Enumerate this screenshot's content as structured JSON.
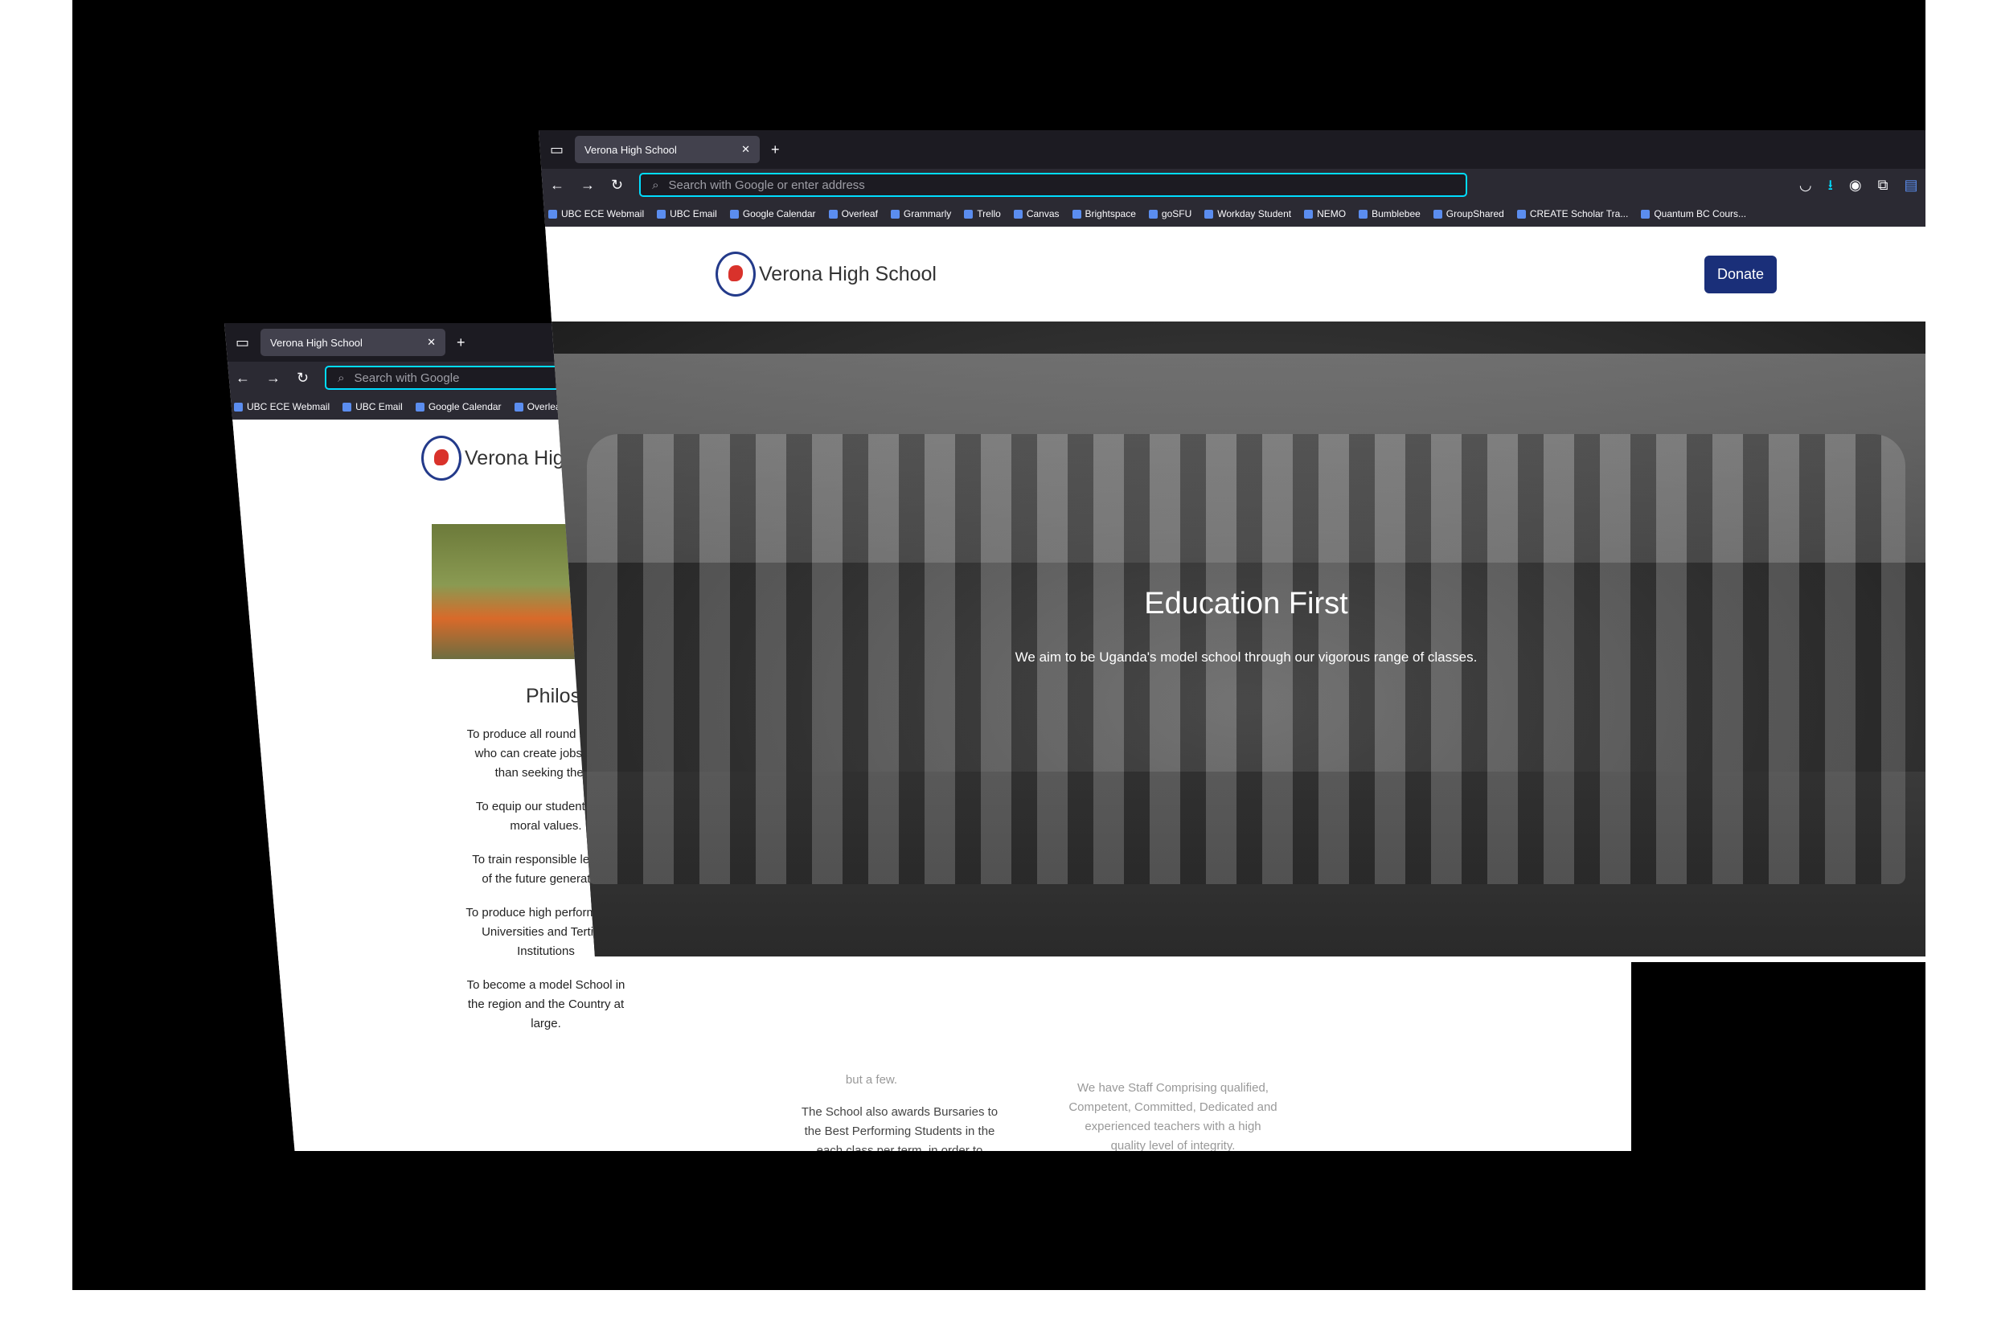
{
  "back_window": {
    "tab_title": "Verona High School",
    "url_placeholder": "Search with Google",
    "bookmarks": [
      "UBC ECE Webmail",
      "UBC Email",
      "Google Calendar",
      "Overleaf"
    ],
    "site_name": "Verona High School",
    "philosophy_title": "Philosophy",
    "philosophy_items": [
      "To produce all round students who can create jobs rather than seeking them.",
      "To equip our students with moral values.",
      "To train responsible leaders of the future generation.",
      "To produce high performers in Universities and Tertiary Institutions",
      "To become a model School in the region and the Country at large."
    ],
    "middle_text_top": "but a few.",
    "middle_text": "The School also awards Bursaries to the Best Performing Students in the each class per term, in order to promote competition among students.",
    "staff_text": "We have Staff Comprising qualified, Competent, Committed, Dedicated and experienced teachers with a high quality level of integrity."
  },
  "front_window": {
    "tab_title": "Verona High School",
    "url_placeholder": "Search with Google or enter address",
    "bookmarks": [
      "UBC ECE Webmail",
      "UBC Email",
      "Google Calendar",
      "Overleaf",
      "Grammarly",
      "Trello",
      "Canvas",
      "Brightspace",
      "goSFU",
      "Workday Student",
      "NEMO",
      "Bumblebee",
      "GroupShared",
      "CREATE Scholar Tra...",
      "Quantum BC Cours..."
    ],
    "site_name": "Verona High School",
    "donate_label": "Donate",
    "hero_title": "Education First",
    "hero_subtitle": "We aim to be Uganda's model school through our vigorous range of classes."
  },
  "colors": {
    "accent": "#1a2f79",
    "urlbar_focus": "#00ddff"
  }
}
